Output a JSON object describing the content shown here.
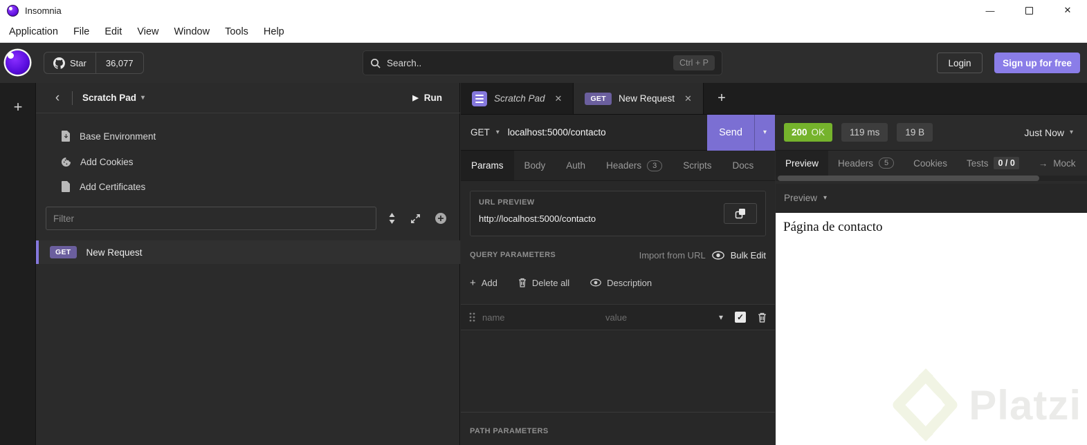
{
  "colors": {
    "accent_purple": "#7b6fd3",
    "signup_purple": "#8a7de8",
    "success_green": "#75b32c",
    "method_badge_purple": "#6b5f9e"
  },
  "icons": {
    "chevron_down": "▾",
    "chevron_left": "‹",
    "play": "▶",
    "plus": "+",
    "close": "✕",
    "minimize": "—",
    "arrow_right": "→",
    "drag_handle": "⸬"
  },
  "titlebar": {
    "app_title": "Insomnia"
  },
  "menubar": {
    "items": [
      "Application",
      "File",
      "Edit",
      "View",
      "Window",
      "Tools",
      "Help"
    ]
  },
  "header": {
    "star_label": "Star",
    "star_count": "36,077",
    "search_placeholder": "Search..",
    "search_shortcut": "Ctrl + P",
    "login_label": "Login",
    "signup_label": "Sign up for free"
  },
  "sidebar": {
    "workspace_name": "Scratch Pad",
    "run_label": "Run",
    "items": [
      {
        "label": "Base Environment"
      },
      {
        "label": "Add Cookies"
      },
      {
        "label": "Add Certificates"
      }
    ],
    "filter_placeholder": "Filter",
    "request": {
      "method": "GET",
      "name": "New Request"
    }
  },
  "tabstrip": {
    "workspace_tab": "Scratch Pad",
    "request_tab": {
      "method": "GET",
      "name": "New Request"
    }
  },
  "request_bar": {
    "method": "GET",
    "url": "localhost:5000/contacto",
    "send_label": "Send"
  },
  "request_tabs": {
    "params": "Params",
    "body": "Body",
    "auth": "Auth",
    "headers": "Headers",
    "headers_count": "3",
    "scripts": "Scripts",
    "docs": "Docs"
  },
  "url_preview": {
    "title": "URL PREVIEW",
    "url": "http://localhost:5000/contacto"
  },
  "query_parameters": {
    "title": "QUERY PARAMETERS",
    "import_from_url": "Import from URL",
    "bulk_edit": "Bulk Edit",
    "add": "Add",
    "delete_all": "Delete all",
    "description": "Description",
    "row": {
      "name_placeholder": "name",
      "value_placeholder": "value"
    }
  },
  "path_parameters": {
    "title": "PATH PARAMETERS"
  },
  "response": {
    "status_code": "200",
    "status_text": "OK",
    "time": "119 ms",
    "size": "19 B",
    "when": "Just Now"
  },
  "response_tabs": {
    "preview": "Preview",
    "headers": "Headers",
    "headers_count": "5",
    "cookies": "Cookies",
    "tests": "Tests",
    "tests_count": "0 / 0",
    "mock": "Mock"
  },
  "response_preview": {
    "mode": "Preview",
    "body_text": "Página de contacto",
    "watermark": "Platzi"
  }
}
